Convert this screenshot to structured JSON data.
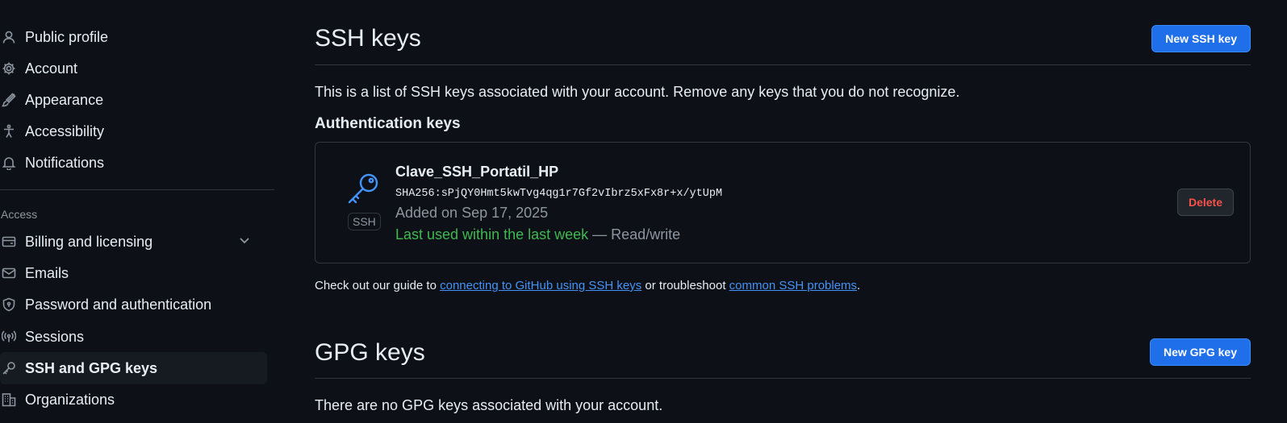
{
  "sidebar": {
    "items": [
      {
        "label": "Public profile",
        "icon": "person-icon"
      },
      {
        "label": "Account",
        "icon": "gear-icon"
      },
      {
        "label": "Appearance",
        "icon": "paintbrush-icon"
      },
      {
        "label": "Accessibility",
        "icon": "accessibility-icon"
      },
      {
        "label": "Notifications",
        "icon": "bell-icon"
      }
    ],
    "access_heading": "Access",
    "access_items": [
      {
        "label": "Billing and licensing",
        "icon": "credit-card-icon",
        "expandable": true
      },
      {
        "label": "Emails",
        "icon": "mail-icon"
      },
      {
        "label": "Password and authentication",
        "icon": "shield-lock-icon"
      },
      {
        "label": "Sessions",
        "icon": "broadcast-icon"
      },
      {
        "label": "SSH and GPG keys",
        "icon": "key-icon",
        "active": true
      },
      {
        "label": "Organizations",
        "icon": "organization-icon"
      }
    ]
  },
  "ssh": {
    "title": "SSH keys",
    "new_button": "New SSH key",
    "description": "This is a list of SSH keys associated with your account. Remove any keys that you do not recognize.",
    "auth_heading": "Authentication keys",
    "key": {
      "name": "Clave_SSH_Portatil_HP",
      "fingerprint": "SHA256:sPjQY0Hmt5kwTvg4qg1r7Gf2vIbrz5xFx8r+x/ytUpM",
      "added": "Added on Sep 17, 2025",
      "last_used": "Last used within the last week",
      "access": "— Read/write",
      "badge": "SSH",
      "delete_label": "Delete"
    },
    "guide": {
      "prefix": "Check out our guide to ",
      "link1": "connecting to GitHub using SSH keys",
      "middle": " or troubleshoot ",
      "link2": "common SSH problems",
      "suffix": "."
    }
  },
  "gpg": {
    "title": "GPG keys",
    "new_button": "New GPG key",
    "empty": "There are no GPG keys associated with your account."
  },
  "colors": {
    "background": "#0d1117",
    "accent": "#1f6feb",
    "link": "#4493f8",
    "success": "#3fb950",
    "danger": "#f85149"
  }
}
